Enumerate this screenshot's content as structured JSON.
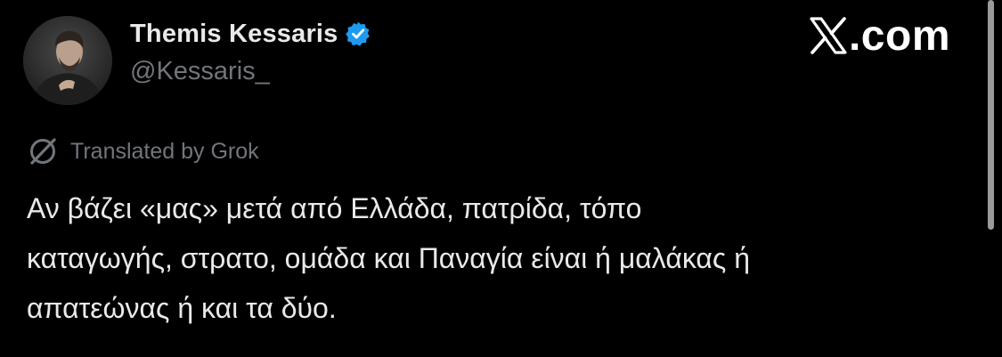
{
  "author": {
    "display_name": "Themis Kessaris",
    "handle": "@Kessaris_",
    "verified": true,
    "avatar": "profile-photo"
  },
  "brand": {
    "icon": "x-logo-icon",
    "domain": ".com"
  },
  "translation": {
    "icon": "grok-icon",
    "label": "Translated by Grok"
  },
  "tweet": {
    "lines": [
      "Αν βάζει «μας» μετά από Ελλάδα, πατρίδα, τόπο",
      "καταγωγής, στρατο, ομάδα και Παναγία είναι ή μαλάκας ή",
      "απατεώνας ή και τα δύο."
    ]
  },
  "colors": {
    "background": "#000000",
    "primary_text": "#e7e9ea",
    "secondary_text": "#71767b",
    "verified_badge": "#1d9bf0"
  }
}
